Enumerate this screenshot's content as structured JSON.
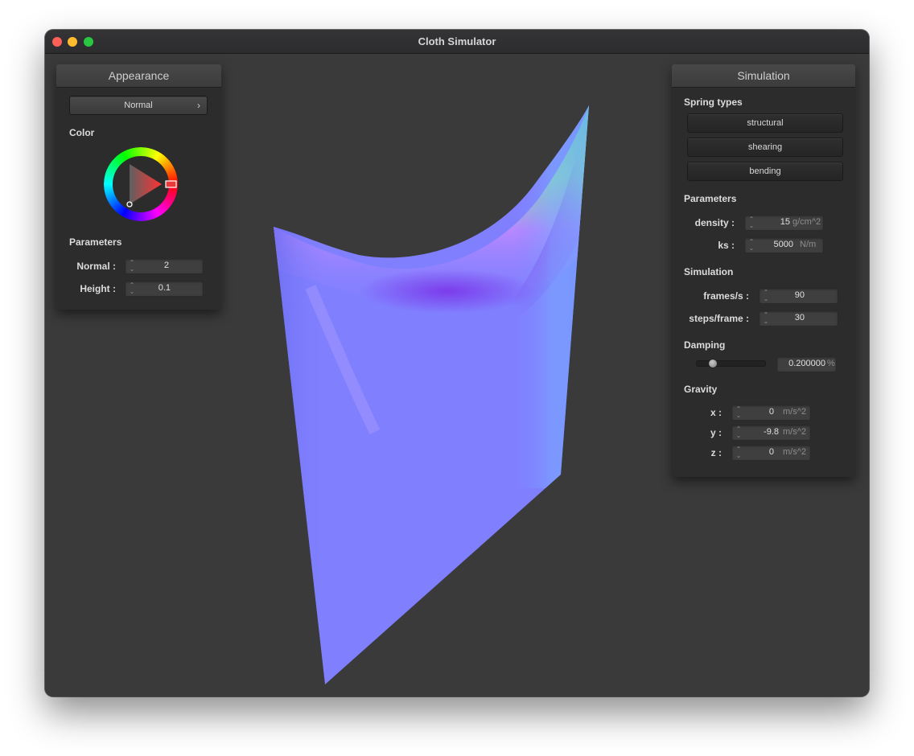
{
  "window": {
    "title": "Cloth Simulator"
  },
  "appearance": {
    "header": "Appearance",
    "shader": "Normal",
    "color_label": "Color",
    "params_label": "Parameters",
    "normal_label": "Normal :",
    "normal_value": "2",
    "height_label": "Height :",
    "height_value": "0.1",
    "selected_color": "#ff0000"
  },
  "simulation": {
    "header": "Simulation",
    "spring_types_label": "Spring types",
    "springs": [
      "structural",
      "shearing",
      "bending"
    ],
    "parameters_label": "Parameters",
    "density_label": "density :",
    "density_value": "15",
    "density_unit": "g/cm^2",
    "ks_label": "ks :",
    "ks_value": "5000",
    "ks_unit": "N/m",
    "simulation_label": "Simulation",
    "fps_label": "frames/s :",
    "fps_value": "90",
    "steps_label": "steps/frame :",
    "steps_value": "30",
    "damping_label": "Damping",
    "damping_value": "0.200000",
    "damping_unit": "%",
    "damping_fraction": 0.2,
    "gravity_label": "Gravity",
    "gx_label": "x :",
    "gx_value": "0",
    "gy_label": "y :",
    "gy_value": "-9.8",
    "gz_label": "z :",
    "gz_value": "0",
    "gravity_unit": "m/s^2"
  },
  "colors": {
    "cloth_base": "#8080ff",
    "background": "#3a3a3a"
  }
}
